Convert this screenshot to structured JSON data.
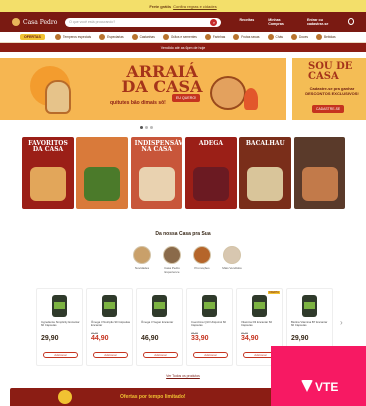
{
  "topbar": {
    "text": "Frete grátis",
    "link": "Confira regras e cidades"
  },
  "header": {
    "brand": "Casa Pedro",
    "search_placeholder": "O que você está procurando?",
    "nav": [
      "Receitas",
      "Minhas Compras",
      "Entrar ou cadastrar-se"
    ]
  },
  "categories": {
    "ofertas": "OFERTAS",
    "items": [
      "Temperos especiais",
      "Especiarias",
      "Castanhas",
      "Grãos e sementes",
      "Farinhas",
      "Frutas secas",
      "Chás",
      "Doces",
      "Bebidas"
    ]
  },
  "promo_strip": "Vendido até as 6pm de hoje",
  "hero": {
    "title": "ARRAIÁ DA CASA",
    "subtitle": "quitutes bão dimais sô!",
    "cta": "EU QUERO!",
    "side_title": "SOU DE CASA",
    "side_text": "Cadastre-se pra ganhar DESCONTOS EXCLUSIVOS!",
    "side_cta": "CADASTRE-SE"
  },
  "cards": [
    {
      "title": "FAVORITOS DA CASA",
      "bg": "#9b1f17"
    },
    {
      "title": "",
      "bg": "#d97a3a"
    },
    {
      "title": "INDISPENSÁVEIS NA CASA",
      "bg": "#c8563a"
    },
    {
      "title": "ADEGA",
      "bg": "#9b1f17"
    },
    {
      "title": "BACALHAU",
      "bg": "#7a2e1a"
    },
    {
      "title": "",
      "bg": "#5a3a2a"
    }
  ],
  "stories": {
    "title": "Da nossa Casa pra Sua",
    "items": [
      "Novidades",
      "Casa Pedro Experience",
      "Promoções",
      "Mais Vendidos"
    ]
  },
  "products": [
    {
      "name": "Ingrediente Simplicity Encantar 60 Cápsulas",
      "old": "",
      "price": "29,90",
      "badge": "",
      "buy": "Adicionar"
    },
    {
      "name": "Ômega 3 Nutrição 90 Cápsulas Encantar",
      "old": "49,90",
      "price": "44,90",
      "badge": "",
      "buy": "Adicionar"
    },
    {
      "name": "Ômega 3 Vegan Encantar",
      "old": "",
      "price": "46,90",
      "badge": "",
      "buy": "Adicionar"
    },
    {
      "name": "Coenzima Q10 Ubiquinol 60 Cápsulas",
      "old": "38,90",
      "price": "33,90",
      "badge": "",
      "buy": "Adicionar"
    },
    {
      "name": "Vitamina D3 Encantar 60 Cápsulas",
      "old": "39,90",
      "price": "34,90",
      "badge": "OFERTA",
      "buy": "Adicionar"
    },
    {
      "name": "Biotina Vitamina B7 Encantar 60 Cápsulas",
      "old": "",
      "price": "29,90",
      "badge": "",
      "buy": "Adicionar"
    }
  ],
  "see_all": "Ver Todos os produtos",
  "bottom_band": "Ofertas por tempo limitado!",
  "vtex_label": "VTE",
  "colors": {
    "primary": "#7a1a12",
    "accent": "#f1c232",
    "cta": "#c5331f",
    "vtex": "#f71963"
  }
}
